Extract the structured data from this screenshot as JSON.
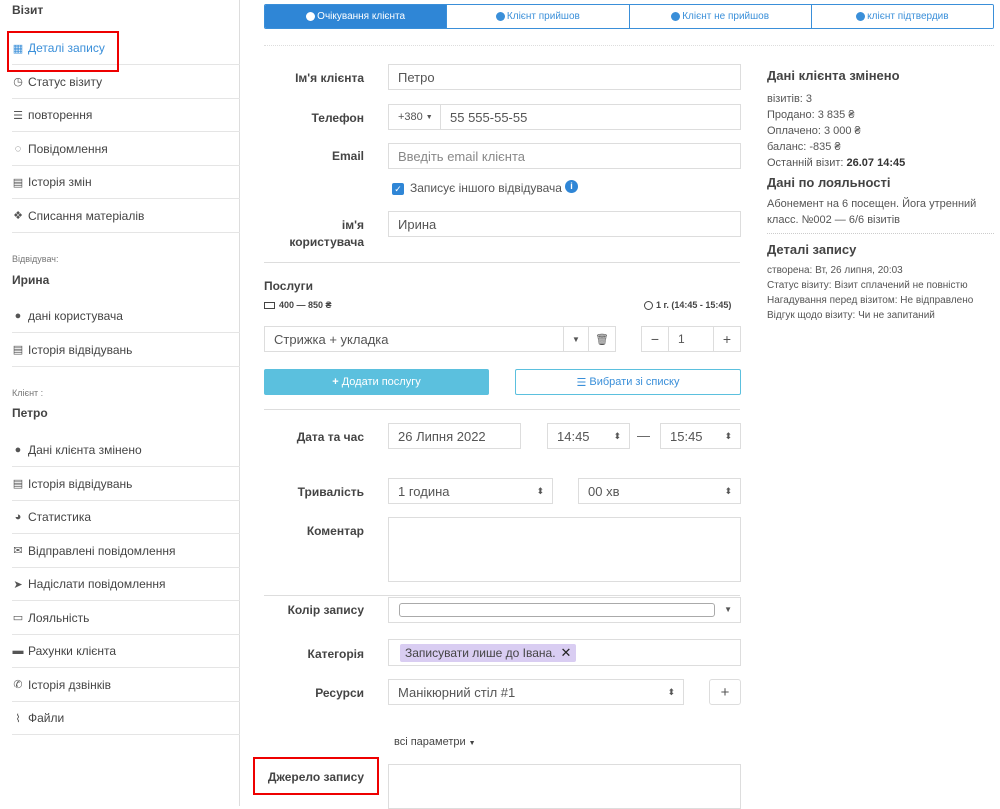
{
  "sidebar": {
    "section_visit": "Візит",
    "visit_items": [
      {
        "icon": "calendar-icon",
        "label": "Деталі запису"
      },
      {
        "icon": "clock-icon",
        "label": "Статус візиту"
      },
      {
        "icon": "list-icon",
        "label": "повторення"
      },
      {
        "icon": "comments-icon",
        "label": "Повідомлення"
      },
      {
        "icon": "file-icon",
        "label": "Історія змін"
      },
      {
        "icon": "cubes-icon",
        "label": "Списання матеріалів"
      }
    ],
    "visitor_caption": "Відвідувач:",
    "visitor_name": "Ирина",
    "visitor_items": [
      {
        "icon": "user-icon",
        "label": "дані користувача"
      },
      {
        "icon": "list-alt-icon",
        "label": "Історія відвідувань"
      }
    ],
    "client_caption": "Клієнт :",
    "client_name": "Петро",
    "client_items": [
      {
        "icon": "user-icon",
        "label": "Дані клієнта змінено"
      },
      {
        "icon": "list-alt-icon",
        "label": "Історія відвідувань"
      },
      {
        "icon": "pie-chart-icon",
        "label": "Статистика"
      },
      {
        "icon": "envelope-icon",
        "label": "Відправлені повідомлення"
      },
      {
        "icon": "send-icon",
        "label": "Надіслати повідомлення"
      },
      {
        "icon": "credit-card-icon",
        "label": "Лояльність"
      },
      {
        "icon": "briefcase-icon",
        "label": "Рахунки клієнта"
      },
      {
        "icon": "phone-icon",
        "label": "Історія дзвінків"
      },
      {
        "icon": "paperclip-icon",
        "label": "Файли"
      }
    ]
  },
  "tabs": [
    {
      "label": "Очікування клієнта",
      "active": true
    },
    {
      "label": "Клієнт прийшов",
      "active": false
    },
    {
      "label": "Клієнт не прийшов",
      "active": false
    },
    {
      "label": "клієнт підтвердив",
      "active": false
    }
  ],
  "form": {
    "client_name_label": "Ім'я клієнта",
    "client_name_value": "Петро",
    "phone_label": "Телефон",
    "phone_code": "+380",
    "phone_value": "55 555-55-55",
    "email_label": "Email",
    "email_placeholder": "Введіть email клієнта",
    "other_visitor_label": "Записує іншого відвідувача",
    "user_name_label_1": "ім'я",
    "user_name_label_2": "користувача",
    "user_name_value": "Ирина",
    "services_label": "Послуги",
    "services_price": "400 — 850 ₴",
    "services_time": "1 г. (14:45 - 15:45)",
    "service_value": "Стрижка + укладка",
    "service_qty": "1",
    "add_service": "Додати послугу",
    "choose_from_list": "Вибрати зі списку",
    "datetime_label": "Дата та час",
    "date_value": "26 Липня 2022",
    "time_from": "14:45",
    "time_dash": "—",
    "time_to": "15:45",
    "duration_label": "Тривалість",
    "duration_hours": "1 година",
    "duration_minutes": "00 хв",
    "comment_label": "Коментар",
    "color_label": "Колір запису",
    "category_label": "Категорія",
    "category_tag": "Записувати лише до Івана.",
    "resources_label": "Ресурси",
    "resources_value": "Манікюрний стіл #1",
    "all_params": "всі параметри",
    "source_label": "Джерело запису"
  },
  "right": {
    "client_changed_title": "Дані клієнта змінено",
    "visits": "візитів: 3",
    "sold": "Продано: 3 835 ₴",
    "paid": "Оплачено: 3 000 ₴",
    "balance": "баланс: -835 ₴",
    "last_visit_label": "Останній візит:",
    "last_visit_value": "26.07 14:45",
    "loyalty_title": "Дані по лояльності",
    "loyalty_line1": "Абонемент на 6 посещен. Йога утренний",
    "loyalty_line2": "класс. №002 — 6/6 візитів",
    "record_details_title": "Деталі запису",
    "created": "створена: Вт, 26 липня, 20:03",
    "visit_status": "Статус візиту: Візит сплачений не повністю",
    "reminder": "Нагадування перед візитом: Не відправлено",
    "feedback": "Відгук щодо візиту: Чи не запитаний"
  },
  "colors": {
    "accent": "#2f86d6",
    "add_button": "#5bc0de",
    "tag_bg": "#d9cdf2",
    "highlight": "#e00000"
  }
}
